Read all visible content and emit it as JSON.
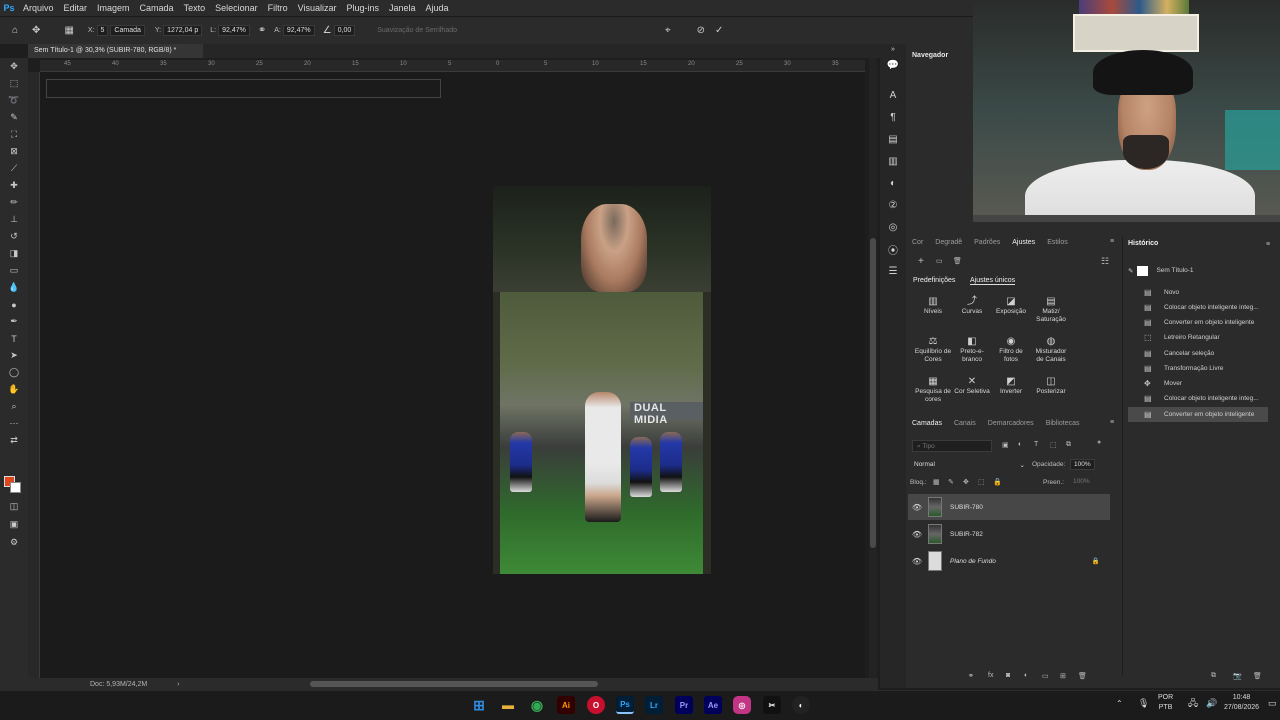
{
  "app": {
    "name": "Adobe Photoshop",
    "logo_text": "Ps"
  },
  "menu": [
    "Arquivo",
    "Editar",
    "Imagem",
    "Camada",
    "Texto",
    "Selecionar",
    "Filtro",
    "Visualizar",
    "Plug-ins",
    "Janela",
    "Ajuda"
  ],
  "options_bar": {
    "x_label": "X:",
    "x_value": "5",
    "layer_select": "Camada",
    "y_label": "Y:",
    "y_value": "1272,04 p",
    "w_label": "L:",
    "w_value": "92,47%",
    "h_label": "A:",
    "h_value": "92,47%",
    "angle_value": "0,00",
    "antialias": "Suavização de Serrilhado"
  },
  "document": {
    "tab_title": "Sem Título-1 @ 30,3% (SUBIR-780, RGB/8) *",
    "banner_text": "DUAL MIDIA",
    "ruler_numbers": [
      "45",
      "40",
      "35",
      "30",
      "25",
      "20",
      "15",
      "10",
      "5",
      "0",
      "5",
      "10",
      "15",
      "20",
      "25",
      "30",
      "35"
    ]
  },
  "status": {
    "zoom": "30,3%",
    "doc_size": "Doc: 5,93M/24,2M"
  },
  "panels": {
    "navigator": "Navegador",
    "adjust_tabs": [
      "Cor",
      "Degradê",
      "Padrões",
      "Ajustes",
      "Estilos"
    ],
    "adjust_subtabs": [
      "Predefinições",
      "Ajustes únicos"
    ],
    "adjustments": [
      {
        "label": "Níveis",
        "icon": "levels-icon",
        "glyph": "▥"
      },
      {
        "label": "Curvas",
        "icon": "curves-icon",
        "glyph": "⤴"
      },
      {
        "label": "Exposição",
        "icon": "exposure-icon",
        "glyph": "◪"
      },
      {
        "label": "Matiz/ Saturação",
        "icon": "hue-saturation-icon",
        "glyph": "▤"
      },
      {
        "label": "Equilíbrio de Cores",
        "icon": "color-balance-icon",
        "glyph": "⚖"
      },
      {
        "label": "Preto-e-branco",
        "icon": "black-white-icon",
        "glyph": "◧"
      },
      {
        "label": "Filtro de fotos",
        "icon": "photo-filter-icon",
        "glyph": "◉"
      },
      {
        "label": "Misturador de Canais",
        "icon": "channel-mixer-icon",
        "glyph": "◍"
      },
      {
        "label": "Pesquisa de cores",
        "icon": "color-lookup-icon",
        "glyph": "▦"
      },
      {
        "label": "Cor Seletiva",
        "icon": "selective-color-icon",
        "glyph": "✕"
      },
      {
        "label": "Inverter",
        "icon": "invert-icon",
        "glyph": "◩"
      },
      {
        "label": "Posterizar",
        "icon": "posterize-icon",
        "glyph": "◫"
      }
    ],
    "layer_tabs": [
      "Camadas",
      "Canais",
      "Demarcadores",
      "Bibliotecas"
    ],
    "layer_search_placeholder": "Tipo",
    "blend_mode": "Normal",
    "opacity_label": "Opacidade:",
    "opacity_value": "100%",
    "lock_label": "Bloq.:",
    "fill_label": "Preen.:",
    "fill_value": "100%",
    "layers": [
      {
        "name": "SUBIR-780",
        "selected": true,
        "italic": false,
        "locked": false
      },
      {
        "name": "SUBIR-782",
        "selected": false,
        "italic": false,
        "locked": false
      },
      {
        "name": "Plano de Fundo",
        "selected": false,
        "italic": true,
        "locked": true
      }
    ],
    "history_title": "Histórico",
    "history_snapshot": "Sem Título-1",
    "history": [
      {
        "label": "Novo",
        "icon": "document-icon",
        "glyph": "▤",
        "active": false
      },
      {
        "label": "Colocar objeto inteligente integ...",
        "icon": "document-icon",
        "glyph": "▤",
        "active": false
      },
      {
        "label": "Converter em objeto inteligente",
        "icon": "document-icon",
        "glyph": "▤",
        "active": false
      },
      {
        "label": "Letreiro Retangular",
        "icon": "marquee-icon",
        "glyph": "⬚",
        "active": false
      },
      {
        "label": "Cancelar seleção",
        "icon": "document-icon",
        "glyph": "▤",
        "active": false
      },
      {
        "label": "Transformação Livre",
        "icon": "document-icon",
        "glyph": "▤",
        "active": false
      },
      {
        "label": "Mover",
        "icon": "move-icon",
        "glyph": "✥",
        "active": false
      },
      {
        "label": "Colocar objeto inteligente integ...",
        "icon": "document-icon",
        "glyph": "▤",
        "active": false
      },
      {
        "label": "Converter em objeto inteligente",
        "icon": "document-icon",
        "glyph": "▤",
        "active": true
      }
    ]
  },
  "taskbar": {
    "apps": [
      {
        "name": "windows-start",
        "label": "⊞",
        "color": "#2f8be0"
      },
      {
        "name": "file-explorer",
        "label": "▬",
        "color": "#e8b33a"
      },
      {
        "name": "chrome",
        "label": "◉",
        "color": "#2aa14a"
      },
      {
        "name": "illustrator",
        "label": "Ai",
        "color": "#330000"
      },
      {
        "name": "opera",
        "label": "O",
        "color": "#c8102e"
      },
      {
        "name": "photoshop",
        "label": "Ps",
        "color": "#001e36"
      },
      {
        "name": "lightroom",
        "label": "Lr",
        "color": "#001e36"
      },
      {
        "name": "premiere",
        "label": "Pr",
        "color": "#00005b"
      },
      {
        "name": "after-effects",
        "label": "Ae",
        "color": "#00005b"
      },
      {
        "name": "instagram",
        "label": "◎",
        "color": "#c13584"
      },
      {
        "name": "capcut",
        "label": "✂",
        "color": "#111111"
      },
      {
        "name": "obs",
        "label": "◐",
        "color": "#222222"
      }
    ],
    "lang_top": "POR",
    "lang_bottom": "PTB",
    "time": "10:48",
    "date": "27/08/2026"
  }
}
